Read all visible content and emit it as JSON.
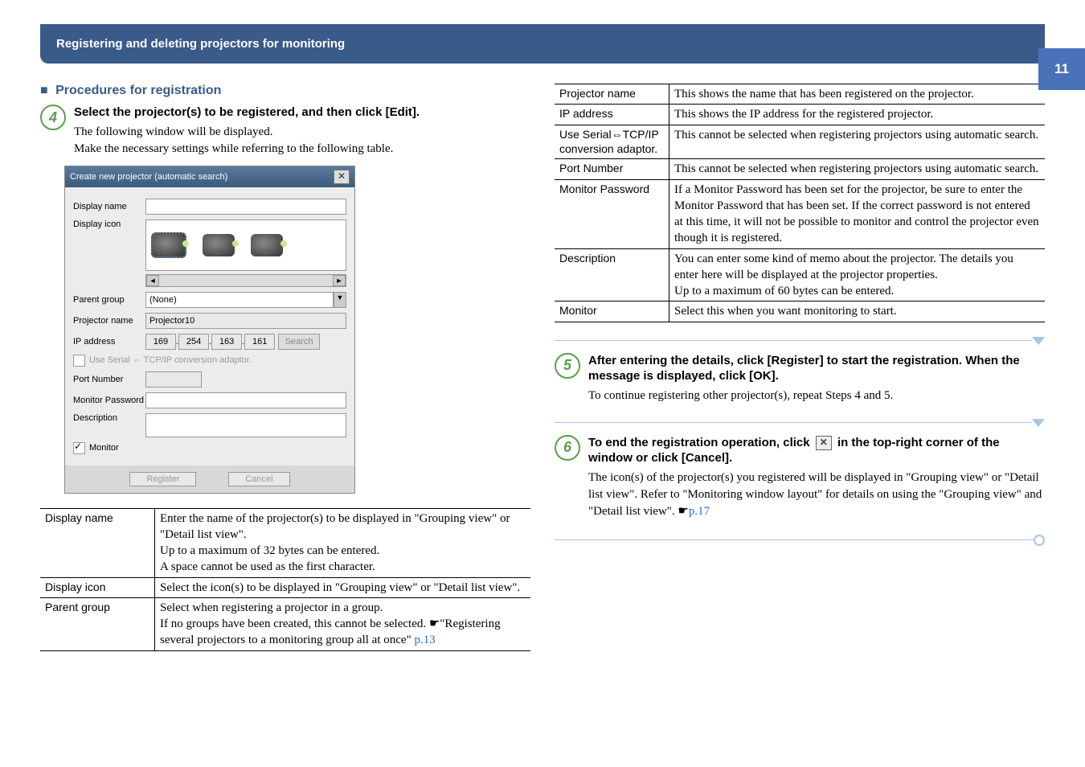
{
  "page_number": "11",
  "header_title": "Registering and deleting projectors for monitoring",
  "section_heading": "Procedures for registration",
  "steps": {
    "s4": {
      "number": "4",
      "title": "Select the projector(s) to be registered, and then click [Edit].",
      "text": "The following window will be displayed.\nMake the necessary settings while referring to the following table."
    },
    "s5": {
      "number": "5",
      "title": "After entering the details, click [Register] to start the registration. When the message is displayed, click [OK].",
      "text": "To continue registering other projector(s), repeat Steps 4 and 5."
    },
    "s6": {
      "number": "6",
      "title_pre": "To end the registration operation, click ",
      "title_post": " in the top-right corner of the window or click [Cancel].",
      "text": "The icon(s) of the projector(s) you registered will be displayed in \"Grouping view\" or \"Detail list view\".\nRefer to \"Monitoring window layout\" for details on using the \"Grouping view\" and \"Detail list view\". ☛",
      "link": "p.17"
    }
  },
  "dialog": {
    "title": "Create new projector (automatic search)",
    "labels": {
      "display_name": "Display name",
      "display_icon": "Display icon",
      "parent_group": "Parent group",
      "projector_name": "Projector name",
      "ip_address": "IP address",
      "use_serial": "Use Serial ⇔ TCP/IP conversion adaptor.",
      "port_number": "Port Number",
      "monitor_password": "Monitor Password",
      "description": "Description",
      "monitor": "Monitor"
    },
    "values": {
      "parent_group": "(None)",
      "projector_name": "Projector10",
      "ip": [
        "169",
        "254",
        "163",
        "161"
      ]
    },
    "buttons": {
      "search": "Search",
      "register": "Register",
      "cancel": "Cancel"
    }
  },
  "table_left": [
    {
      "key": "Display name",
      "val": "Enter the name of the projector(s) to be displayed in \"Grouping view\" or \"Detail list view\".\nUp to a maximum of 32 bytes can be entered.\nA space cannot be used as the first character."
    },
    {
      "key": "Display icon",
      "val": "Select the icon(s) to be displayed in \"Grouping view\" or \"Detail list view\"."
    },
    {
      "key": "Parent group",
      "val": "Select when registering a projector in a group.\nIf no groups have been created, this cannot be selected. ☛\"Registering several projectors to a monitoring group all at once\" ",
      "link": "p.13"
    }
  ],
  "table_right": [
    {
      "key": "Projector name",
      "val": "This shows the name that has been registered on the projector."
    },
    {
      "key": "IP address",
      "val": "This shows the IP address for the registered projector."
    },
    {
      "key": "Use Serial⇔TCP/IP conversion adaptor.",
      "val": "This cannot be selected when registering projectors using automatic search."
    },
    {
      "key": "Port Number",
      "val": "This cannot be selected when registering projectors using automatic search."
    },
    {
      "key": "Monitor Password",
      "val": "If a Monitor Password has been set for the projector, be sure to enter the Monitor Password that has been set. If the correct password is not entered at this time, it will not be possible to monitor and control the projector even though it is registered."
    },
    {
      "key": "Description",
      "val": "You can enter some kind of memo about the projector. The details you enter here will be displayed at the projector properties.\nUp to a maximum of 60 bytes can be entered."
    },
    {
      "key": "Monitor",
      "val": "Select this when you want monitoring to start."
    }
  ]
}
